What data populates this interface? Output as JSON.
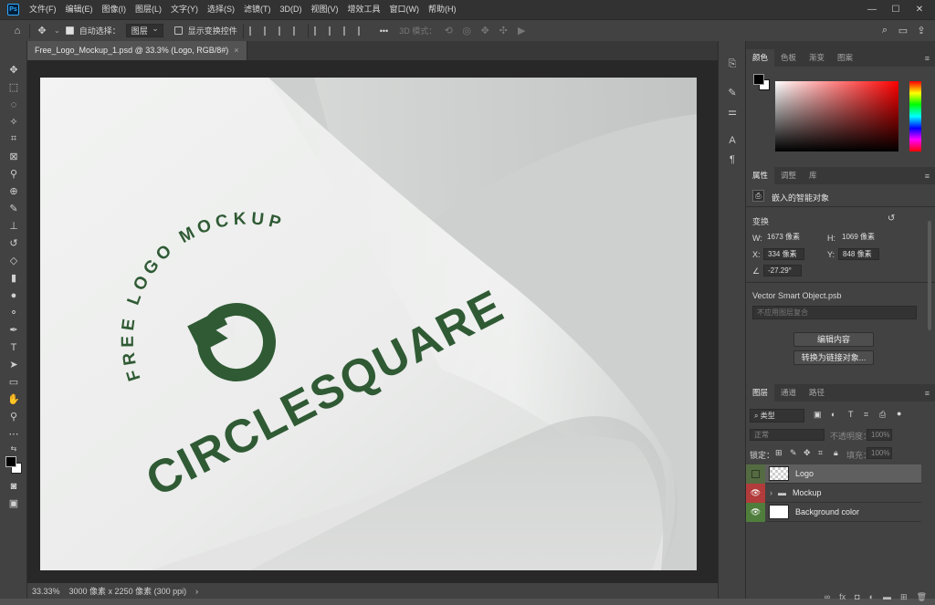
{
  "app": {
    "logo_text": "Ps"
  },
  "menu": [
    "文件(F)",
    "编辑(E)",
    "图像(I)",
    "图层(L)",
    "文字(Y)",
    "选择(S)",
    "滤镜(T)",
    "3D(D)",
    "视图(V)",
    "增效工具",
    "窗口(W)",
    "帮助(H)"
  ],
  "window_controls": {
    "minimize": "—",
    "maximize": "☐",
    "close": "✕"
  },
  "options": {
    "auto_select_label": "自动选择：",
    "auto_select_value": "图层",
    "show_transform_label": "显示变换控件",
    "more": "•••",
    "mode_3d_label": "3D 模式："
  },
  "document": {
    "tab_title": "Free_Logo_Mockup_1.psd @ 33.3% (Logo, RGB/8#)",
    "tab_close": "×"
  },
  "artwork": {
    "arc_text": "FREE LOGO MOCKUP",
    "brand_text": "CIRCLESQUARE",
    "brand_color": "#2f5a34"
  },
  "status": {
    "zoom": "33.33%",
    "doc_info": "3000 像素 x 2250 像素 (300 ppi)",
    "arrow": "›"
  },
  "color_panel": {
    "tabs": [
      "颜色",
      "色板",
      "渐变",
      "图案"
    ],
    "active_tab": 0,
    "foreground": "#000000",
    "background": "#ffffff",
    "hue_color": "#ff0000"
  },
  "properties_panel": {
    "tabs": [
      "属性",
      "调整",
      "库"
    ],
    "active_tab": 0,
    "object_type": "嵌入的智能对象",
    "transform_label": "变换",
    "w_label": "W:",
    "w_value": "1673 像素",
    "h_label": "H:",
    "h_value": "1069 像素",
    "x_label": "X:",
    "x_value": "334 像素",
    "y_label": "Y:",
    "y_value": "848 像素",
    "angle_value": "-27.29°",
    "source_name": "Vector Smart Object.psb",
    "comp_placeholder": "不应用图层复合",
    "edit_button": "编辑内容",
    "convert_button": "转换为链接对象..."
  },
  "layers_panel": {
    "tabs": [
      "图层",
      "通道",
      "路径"
    ],
    "active_tab": 0,
    "filter_label": "类型",
    "blend_mode": "正常",
    "opacity_label": "不透明度：",
    "opacity_value": "100%",
    "lock_label": "锁定：",
    "fill_label": "填充：",
    "fill_value": "100%",
    "layers": [
      {
        "name": "Logo",
        "selected": true,
        "visible": false
      },
      {
        "name": "Mockup",
        "selected": false,
        "visible": true,
        "group": true
      },
      {
        "name": "Background color",
        "selected": false,
        "visible": true
      }
    ]
  }
}
